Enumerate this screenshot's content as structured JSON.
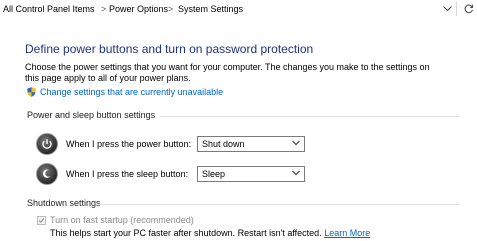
{
  "breadcrumb": {
    "items": [
      "All Control Panel Items",
      "Power Options",
      "System Settings"
    ],
    "separator": ">"
  },
  "page": {
    "title": "Define power buttons and turn on password protection",
    "intro": "Choose the power settings that you want for your computer. The changes you make to the settings on this page apply to all of your power plans.",
    "change_link": "Change settings that are currently unavailable"
  },
  "power_sleep": {
    "heading": "Power and sleep button settings",
    "power_button_label": "When I press the power button:",
    "power_button_value": "Shut down",
    "sleep_button_label": "When I press the sleep button:",
    "sleep_button_value": "Sleep"
  },
  "shutdown": {
    "heading": "Shutdown settings",
    "fast_startup_label": "Turn on fast startup (recommended)",
    "fast_startup_checked": true,
    "fast_startup_desc": "This helps start your PC faster after shutdown. Restart isn't affected.",
    "learn_more": "Learn More"
  },
  "colors": {
    "title": "#1e3287",
    "link": "#0066cc",
    "disabled_text": "#8a8a8a"
  },
  "icons": [
    "chevron-down-icon",
    "refresh-icon",
    "uac-shield-icon",
    "power-button-icon",
    "sleep-button-icon"
  ]
}
